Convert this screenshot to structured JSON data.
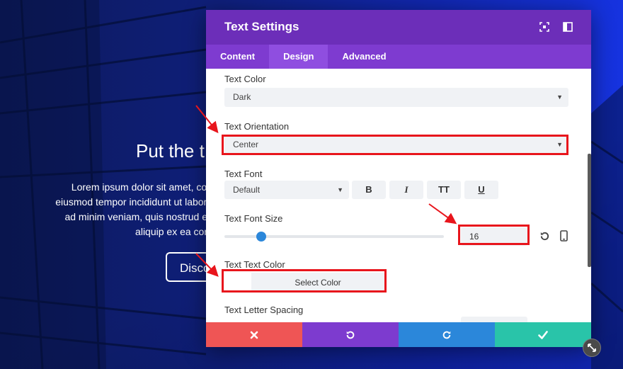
{
  "hero": {
    "title": "Put the t",
    "body_lines": [
      "Lorem ipsum dolor sit amet, con",
      "eiusmod tempor incididunt ut labore",
      "ad minim veniam, quis nostrud ex",
      "aliquip ex ea com"
    ],
    "button_label": "Disco"
  },
  "modal": {
    "title": "Text Settings",
    "tabs": [
      {
        "label": "Content",
        "active": false
      },
      {
        "label": "Design",
        "active": true
      },
      {
        "label": "Advanced",
        "active": false
      }
    ],
    "fields": {
      "text_color": {
        "label": "Text Color",
        "value": "Dark"
      },
      "text_orientation": {
        "label": "Text Orientation",
        "value": "Center"
      },
      "text_font": {
        "label": "Text Font",
        "value": "Default",
        "styles": [
          "B",
          "I",
          "TT",
          "U"
        ]
      },
      "text_font_size": {
        "label": "Text Font Size",
        "value": "16",
        "slider_fraction": 0.16
      },
      "text_text_color": {
        "label": "Text Text Color",
        "button": "Select Color"
      },
      "text_letter_spacing": {
        "label": "Text Letter Spacing"
      }
    },
    "footer": [
      {
        "name": "cancel",
        "color": "#ef5555"
      },
      {
        "name": "undo",
        "color": "#7d3bcf"
      },
      {
        "name": "redo",
        "color": "#2b87da"
      },
      {
        "name": "save",
        "color": "#29c4a9"
      }
    ]
  },
  "colors": {
    "header": "#6c2eb9",
    "tabs": "#7e3bd0",
    "tab_active": "#8f4ee0",
    "annotation": "#e8151c",
    "slider": "#2b87da"
  }
}
